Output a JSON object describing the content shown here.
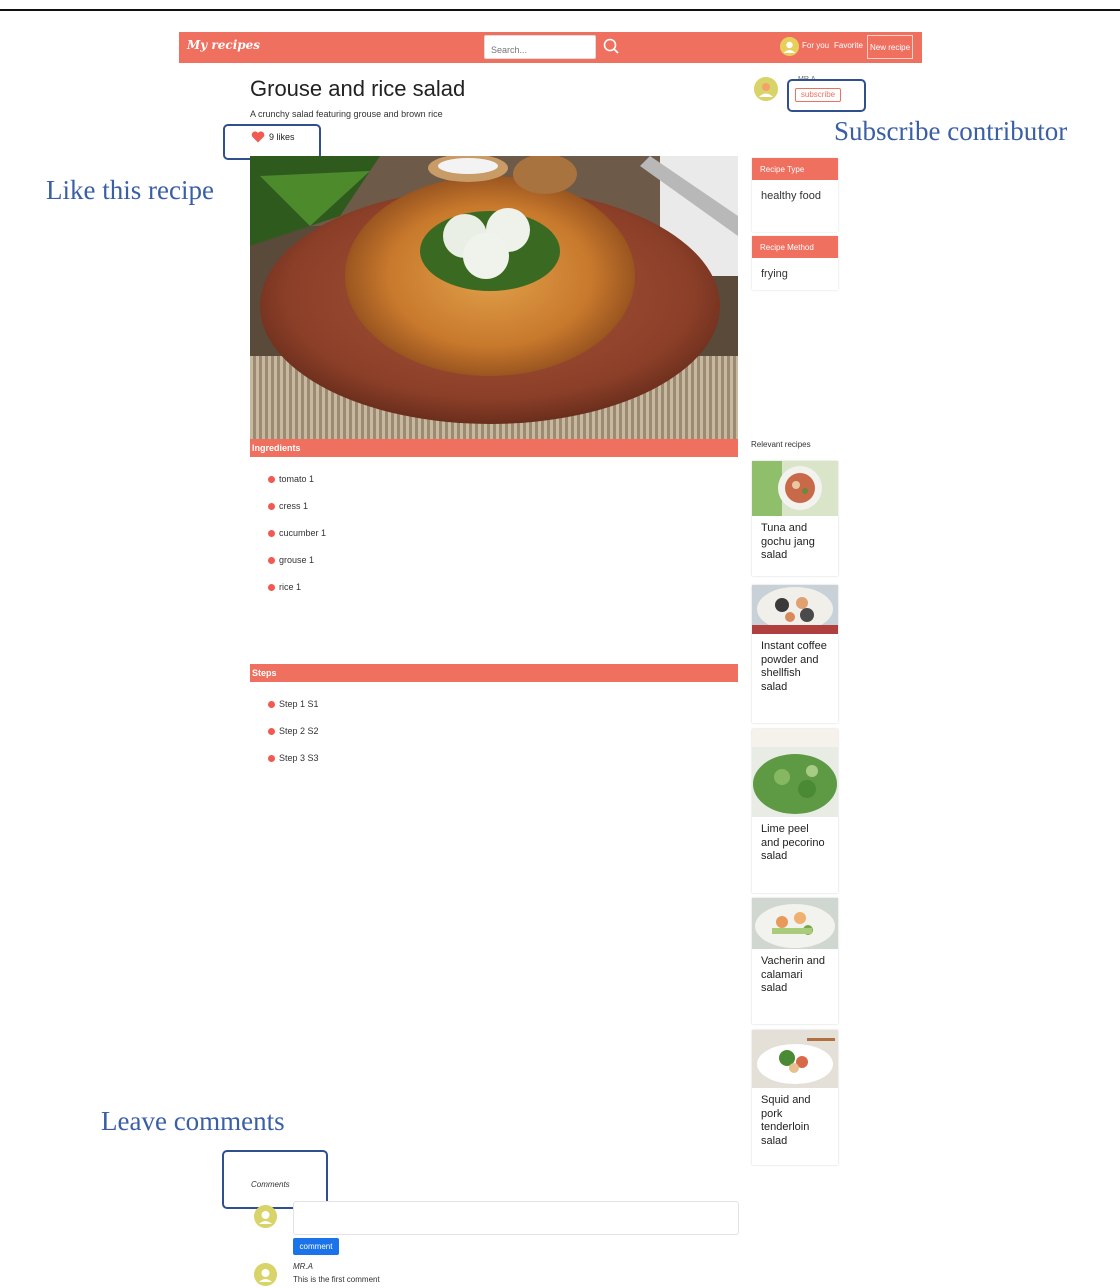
{
  "navbar": {
    "brand": "My recipes",
    "search_placeholder": "Search...",
    "links": [
      "For you",
      "Favorite"
    ],
    "new_recipe": "New recipe",
    "color": "#f07060"
  },
  "recipe": {
    "title": "Grouse and rice salad",
    "subtitle": "A crunchy salad featuring grouse and brown rice",
    "likes": "9 likes"
  },
  "author": {
    "name": "MR.A",
    "subscribe": "subscribe"
  },
  "annotations": {
    "like": "Like this recipe",
    "subscribe": "Subscribe contributor",
    "comments": "Leave comments"
  },
  "ingredients": {
    "header": "Ingredients",
    "items": [
      "tomato 1",
      "cress 1",
      "cucumber 1",
      "grouse 1",
      "rice 1"
    ]
  },
  "steps": {
    "header": "Steps",
    "items": [
      "Step 1 S1",
      "Step 2 S2",
      "Step 3 S3"
    ]
  },
  "sidebar": {
    "recipe_type_header": "Recipe Type",
    "recipe_type": "healthy food",
    "recipe_method_header": "Recipe Method",
    "recipe_method": "frying",
    "relevant_title": "Relevant recipes",
    "relevant": [
      "Tuna and gochu jang salad",
      "Instant coffee powder and shellfish salad",
      "Lime peel and pecorino salad",
      "Vacherin and calamari salad",
      "Squid and pork tenderloin salad"
    ]
  },
  "comments": {
    "label": "Comments",
    "button": "comment",
    "items": [
      {
        "author": "MR.A",
        "text": "This is the first comment"
      }
    ]
  }
}
